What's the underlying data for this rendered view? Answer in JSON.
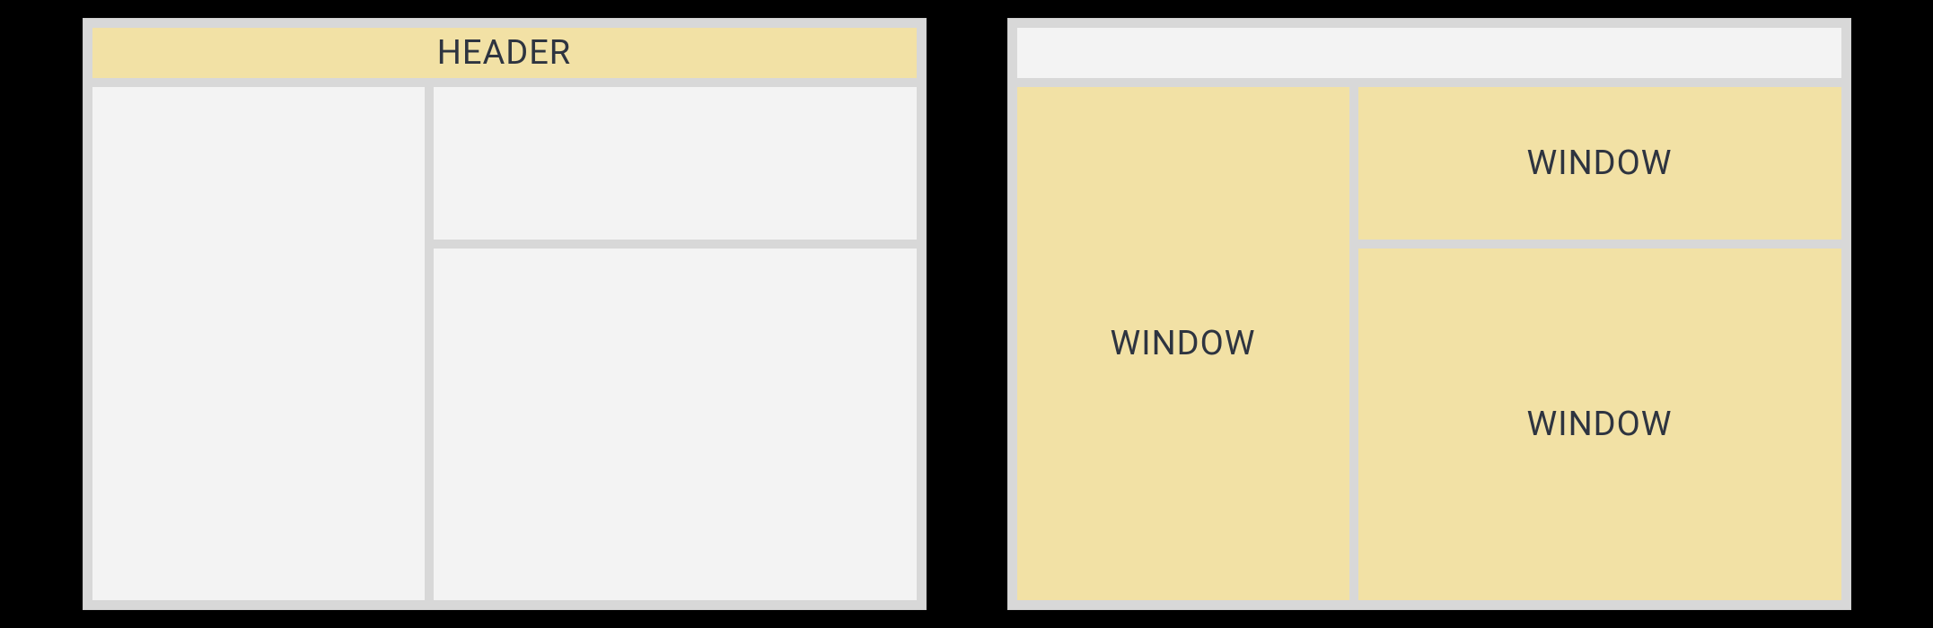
{
  "diagram": {
    "left": {
      "header_label": "HEADER",
      "left_pane_label": "",
      "top_right_pane_label": "",
      "bottom_right_pane_label": ""
    },
    "right": {
      "header_label": "",
      "left_pane_label": "WINDOW",
      "top_right_pane_label": "WINDOW",
      "bottom_right_pane_label": "WINDOW"
    },
    "colors": {
      "highlight_fill": "#f2e1a5",
      "plain_fill": "#f3f3f3",
      "frame_background": "#d8d8d8",
      "page_background": "#000000",
      "text_color": "#2e3440"
    }
  }
}
